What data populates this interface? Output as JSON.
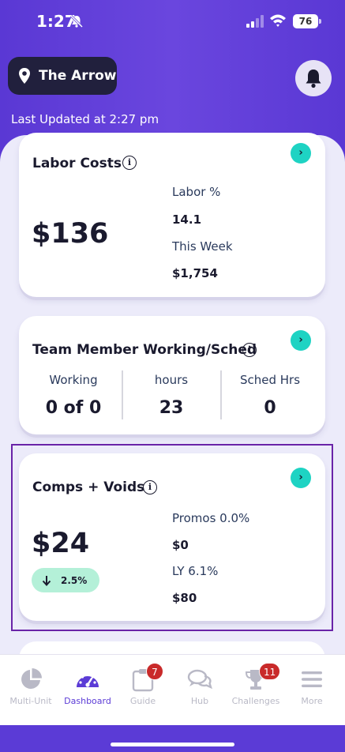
{
  "status": {
    "time": "1:27",
    "battery": "76"
  },
  "header": {
    "location": "The Arrow",
    "last_updated": "Last Updated at 2:27 pm"
  },
  "labor_card": {
    "title": "Labor Costs",
    "value": "$136",
    "labor_pct_label": "Labor %",
    "labor_pct_value": "14.1",
    "this_week_label": "This Week",
    "this_week_value": "$1,754",
    "arrow": "›"
  },
  "team_card": {
    "title": "Team Member Working/Sched",
    "columns": [
      {
        "label": "Working",
        "value": "0 of 0"
      },
      {
        "label": "hours",
        "value": "23"
      },
      {
        "label": "Sched Hrs",
        "value": "0"
      }
    ],
    "arrow": "›"
  },
  "comps_card": {
    "title": "Comps + Voids",
    "value": "$24",
    "trend": "2.5%",
    "trend_direction": "down",
    "promos_label": "Promos 0.0%",
    "promos_value": "$0",
    "ly_label": "LY 6.1%",
    "ly_value": "$80",
    "arrow": "›"
  },
  "tabs": [
    {
      "label": "Multi-Unit",
      "icon": "pie-chart-icon",
      "active": false
    },
    {
      "label": "Dashboard",
      "icon": "speedometer-icon",
      "active": true
    },
    {
      "label": "Guide",
      "icon": "clipboard-icon",
      "active": false,
      "badge": "7"
    },
    {
      "label": "Hub",
      "icon": "chat-bubbles-icon",
      "active": false
    },
    {
      "label": "Challenges",
      "icon": "trophy-icon",
      "active": false,
      "badge": "11"
    },
    {
      "label": "More",
      "icon": "menu-icon",
      "active": false
    }
  ],
  "colors": {
    "brand_purple": "#5b3bd6",
    "accent_teal": "#1ed3c3",
    "badge_red": "#c92a2a",
    "trend_green": "#b4f0d8"
  }
}
